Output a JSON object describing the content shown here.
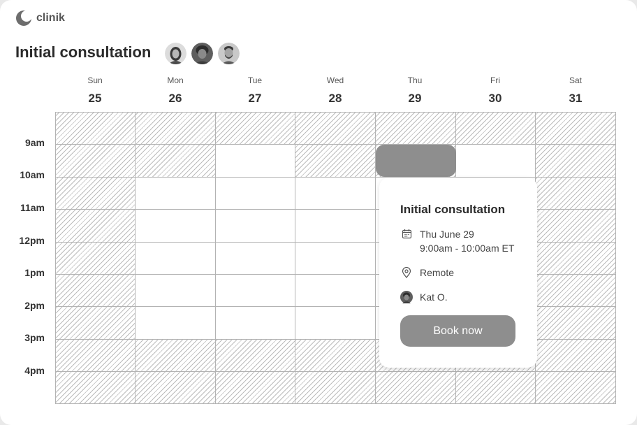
{
  "app": {
    "name": "clinik",
    "logo_icon": "clinik-logo-icon"
  },
  "header": {
    "title": "Initial consultation",
    "avatars": [
      "avatar-woman",
      "avatar-man-curly",
      "avatar-man-beard"
    ]
  },
  "calendar": {
    "days": [
      {
        "dow": "Sun",
        "date": "25"
      },
      {
        "dow": "Mon",
        "date": "26"
      },
      {
        "dow": "Tue",
        "date": "27"
      },
      {
        "dow": "Wed",
        "date": "28"
      },
      {
        "dow": "Thu",
        "date": "29"
      },
      {
        "dow": "Fri",
        "date": "30"
      },
      {
        "dow": "Sat",
        "date": "31"
      }
    ],
    "times": [
      "9am",
      "10am",
      "11am",
      "12pm",
      "1pm",
      "2pm",
      "3pm",
      "4pm"
    ],
    "selected_day": "Thu"
  },
  "popup": {
    "title": "Initial consultation",
    "date": "Thu June 29",
    "time": "9:00am - 10:00am ET",
    "location": "Remote",
    "provider": "Kat O.",
    "book_label": "Book now",
    "icons": [
      "calendar-icon",
      "location-pin-icon",
      "provider-avatar"
    ]
  },
  "colors": {
    "accent": "#8e8e8e",
    "hatch": "#bcbcbc",
    "grid_line": "#b3b3b3"
  }
}
